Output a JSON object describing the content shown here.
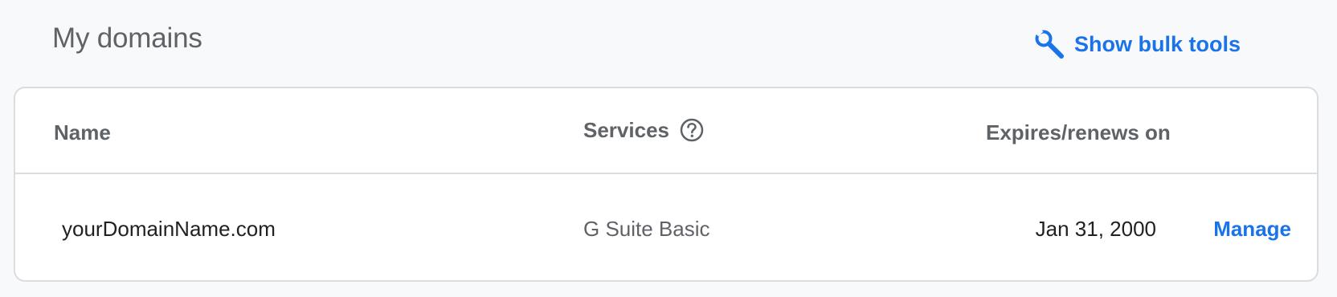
{
  "header": {
    "title": "My domains",
    "bulk_tools_label": "Show bulk tools",
    "bulk_tools_icon": "wrench-magnifier-icon"
  },
  "table": {
    "columns": {
      "name": "Name",
      "services": "Services",
      "expires": "Expires/renews on"
    },
    "rows": [
      {
        "name": "yourDomainName.com",
        "service": "G Suite Basic",
        "expires": "Jan 31, 2000",
        "action": "Manage"
      }
    ]
  },
  "colors": {
    "accent": "#1a73e8",
    "muted_text": "#5f6368",
    "border": "#dadce0",
    "background": "#f8f9fa"
  }
}
